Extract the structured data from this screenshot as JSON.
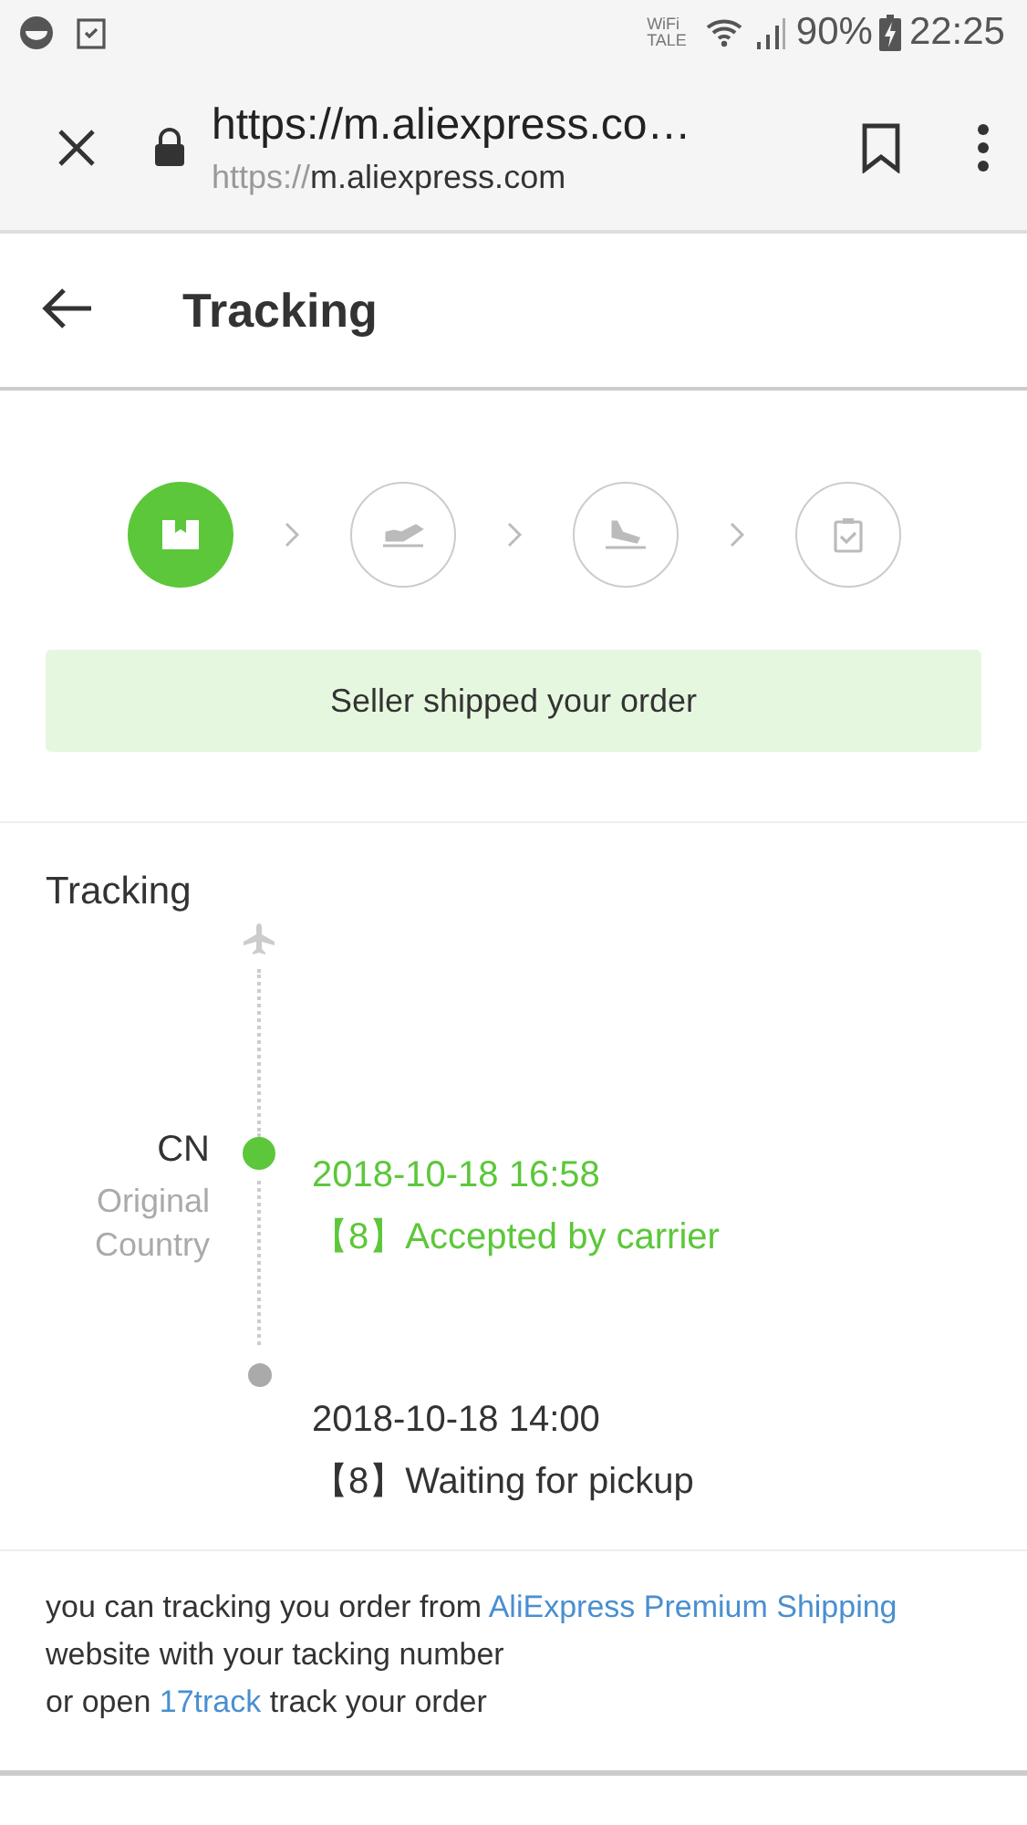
{
  "status_bar": {
    "network_label_top": "WiFi",
    "network_label_bottom": "TALE",
    "battery": "90%",
    "time": "22:25"
  },
  "browser": {
    "title": "https://m.aliexpress.co…",
    "url_scheme": "https://",
    "url_host": "m.aliexpress.com"
  },
  "header": {
    "title": "Tracking"
  },
  "shipping": {
    "steps": [
      {
        "kind": "package",
        "done": true
      },
      {
        "kind": "departure",
        "done": false
      },
      {
        "kind": "arrival",
        "done": false
      },
      {
        "kind": "delivered",
        "done": false
      }
    ],
    "message": "Seller shipped your order"
  },
  "tracking": {
    "heading": "Tracking",
    "origin": {
      "code": "CN",
      "label": "Original Country"
    },
    "events": [
      {
        "time": "2018-10-18 16:58",
        "text": "【8】Accepted by carrier",
        "current": true
      },
      {
        "time": "2018-10-18 14:00",
        "text": "【8】Waiting for pickup",
        "current": false
      }
    ]
  },
  "footer": {
    "lines": [
      [
        {
          "kind": "text",
          "text": "you can tracking you order from "
        },
        {
          "kind": "link",
          "text": "AliExpress Premium Shipping"
        },
        {
          "kind": "text",
          "text": " website with your tacking number"
        }
      ],
      [
        {
          "kind": "text",
          "text": "or open "
        },
        {
          "kind": "link",
          "text": "17track"
        },
        {
          "kind": "text",
          "text": " track your order"
        }
      ]
    ]
  }
}
